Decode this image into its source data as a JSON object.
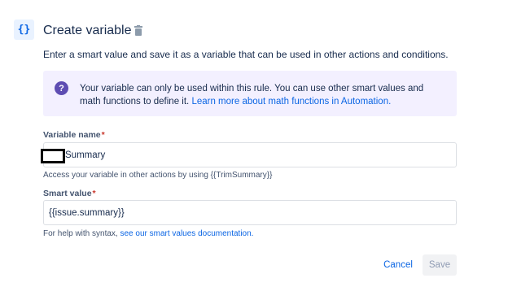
{
  "header": {
    "icon": "curly-braces-icon",
    "icon_glyph": "{}",
    "title": "Create variable",
    "delete_icon": "trash-icon"
  },
  "description": "Enter a smart value and save it as a variable that can be used in other actions and conditions.",
  "info": {
    "icon_glyph": "?",
    "text": "Your variable can only be used within this rule. You can use other smart values and math functions to define it. ",
    "link": "Learn more about math functions in Automation."
  },
  "variable_name": {
    "label": "Variable name",
    "required_mark": "*",
    "value": "Summary",
    "help": "Access your variable in other actions by using {{TrimSummary}}"
  },
  "smart_value": {
    "label": "Smart value",
    "required_mark": "*",
    "value": "{{issue.summary}}",
    "help_prefix": "For help with syntax, ",
    "help_link": "see our smart values documentation."
  },
  "actions": {
    "cancel_label": "Cancel",
    "save_label": "Save"
  },
  "colors": {
    "accent": "#0c66e4",
    "info_bg": "#f3f0ff",
    "info_icon": "#5e4db2",
    "required": "#c9372c"
  }
}
